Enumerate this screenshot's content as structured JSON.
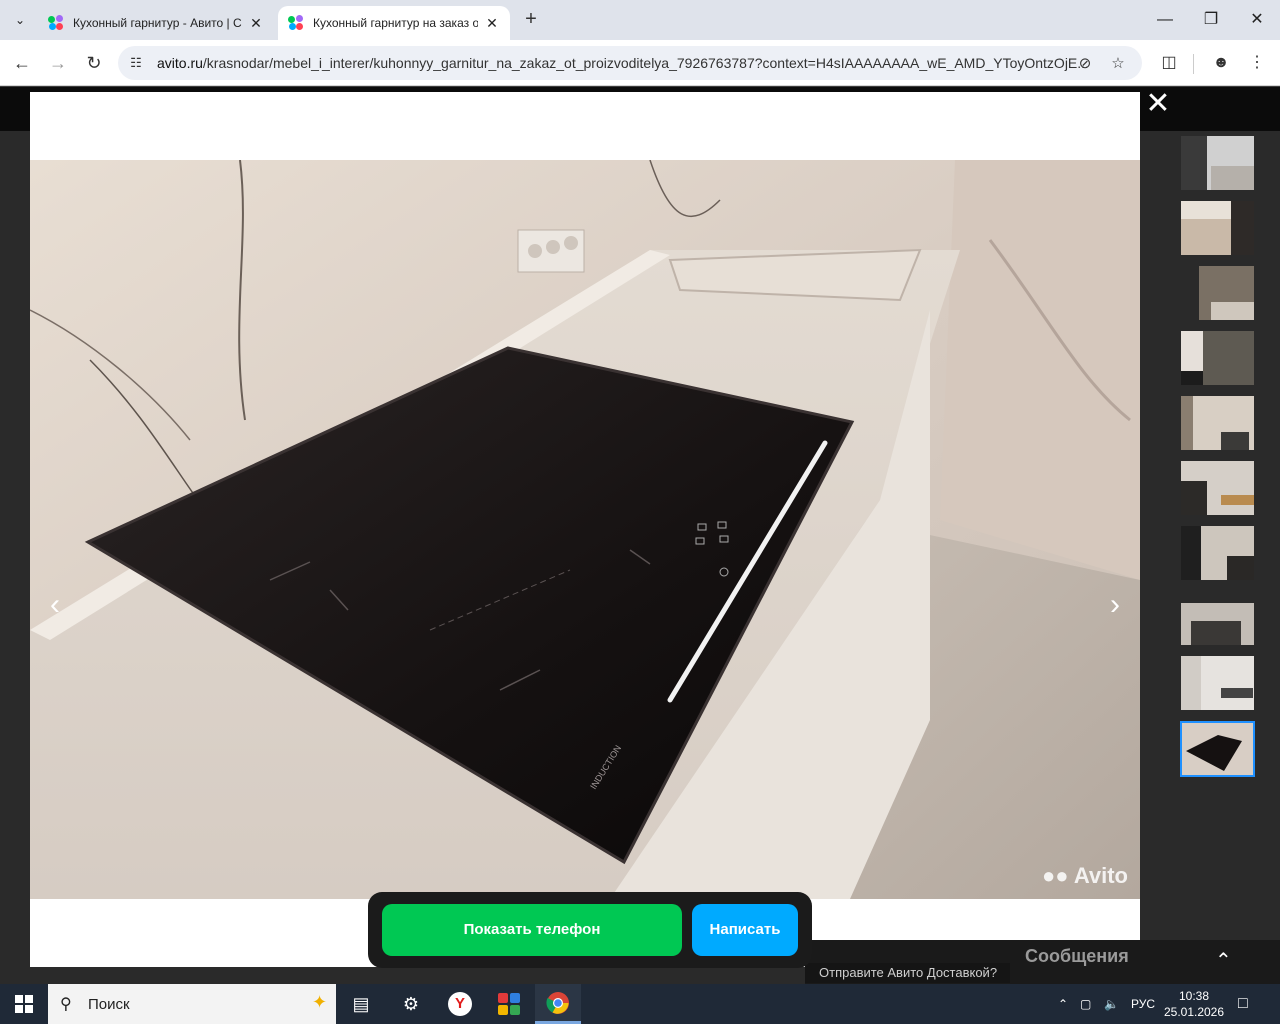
{
  "browser": {
    "tabs": [
      {
        "title": "Кухонный гарнитур - Авито | С",
        "active": false
      },
      {
        "title": "Кухонный гарнитур на заказ о",
        "active": true
      }
    ],
    "url_domain": "avito.ru",
    "url_path": "/krasnodar/mebel_i_interer/kuhonnyy_garnitur_na_zakaz_ot_proizvoditelya_7926763787?context=H4sIAAAAAAAA_wE_AMD_YToyOntzOjE...",
    "icons": {
      "tab_search": "chevron-down-icon",
      "new_tab": "plus-icon",
      "back": "arrow-left-icon",
      "forward": "arrow-right-icon",
      "reload": "reload-icon",
      "site_info": "tune-icon",
      "tracking": "eye-off-icon",
      "bookmark": "star-icon",
      "extensions": "puzzle-icon",
      "profile": "account-icon",
      "menu": "kebab-icon"
    }
  },
  "gallery": {
    "watermark": "Avito",
    "photo_text": "INDUCTION",
    "thumbnail_count": 10,
    "selected_thumbnail": 10
  },
  "actions": {
    "show_phone": "Показать телефон",
    "write": "Написать"
  },
  "background_page": {
    "delivery_text": "Отправите Авито Доставкой?",
    "messages_text": "Сообщения"
  },
  "taskbar": {
    "search_placeholder": "Поиск",
    "language": "РУС",
    "time": "10:38",
    "date": "25.01.2026"
  },
  "colors": {
    "phone_button": "#00c853",
    "write_button": "#00aaff",
    "selected_thumb_border": "#1e90ff"
  }
}
